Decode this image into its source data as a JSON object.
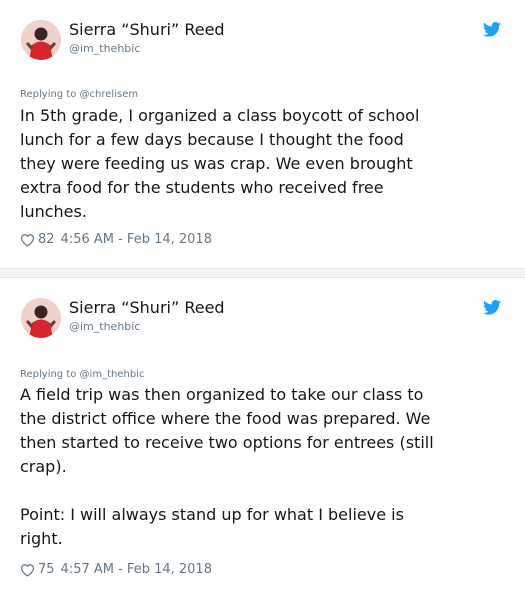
{
  "colors": {
    "text": "#14171a",
    "secondary": "#657786",
    "twitter_blue": "#1da1f2"
  },
  "tweets": [
    {
      "author_name": "Sierra “Shuri” Reed",
      "handle": "@im_thehbic",
      "replying_to": "Replying to @chrelisem",
      "text": "In 5th grade, I organized a class boycott of school\nlunch for a few days because I thought the food\nthey were feeding us was crap. We even brought\nextra food for the students who received free\nlunches.",
      "likes": "82",
      "timestamp": "4:56 AM - Feb 14, 2018",
      "icons": [
        "avatar",
        "twitter-bird-icon",
        "heart-icon"
      ]
    },
    {
      "author_name": "Sierra “Shuri” Reed",
      "handle": "@im_thehbic",
      "replying_to": "Replying to @im_thehbic",
      "text": "A field trip was then organized to take our class to\nthe district office where the food was prepared. We\nthen started to receive two options for entrees (still\ncrap).\n\nPoint: I will always stand up for what I believe is\nright.",
      "likes": "75",
      "timestamp": "4:57 AM - Feb 14, 2018",
      "icons": [
        "avatar",
        "twitter-bird-icon",
        "heart-icon"
      ]
    }
  ]
}
